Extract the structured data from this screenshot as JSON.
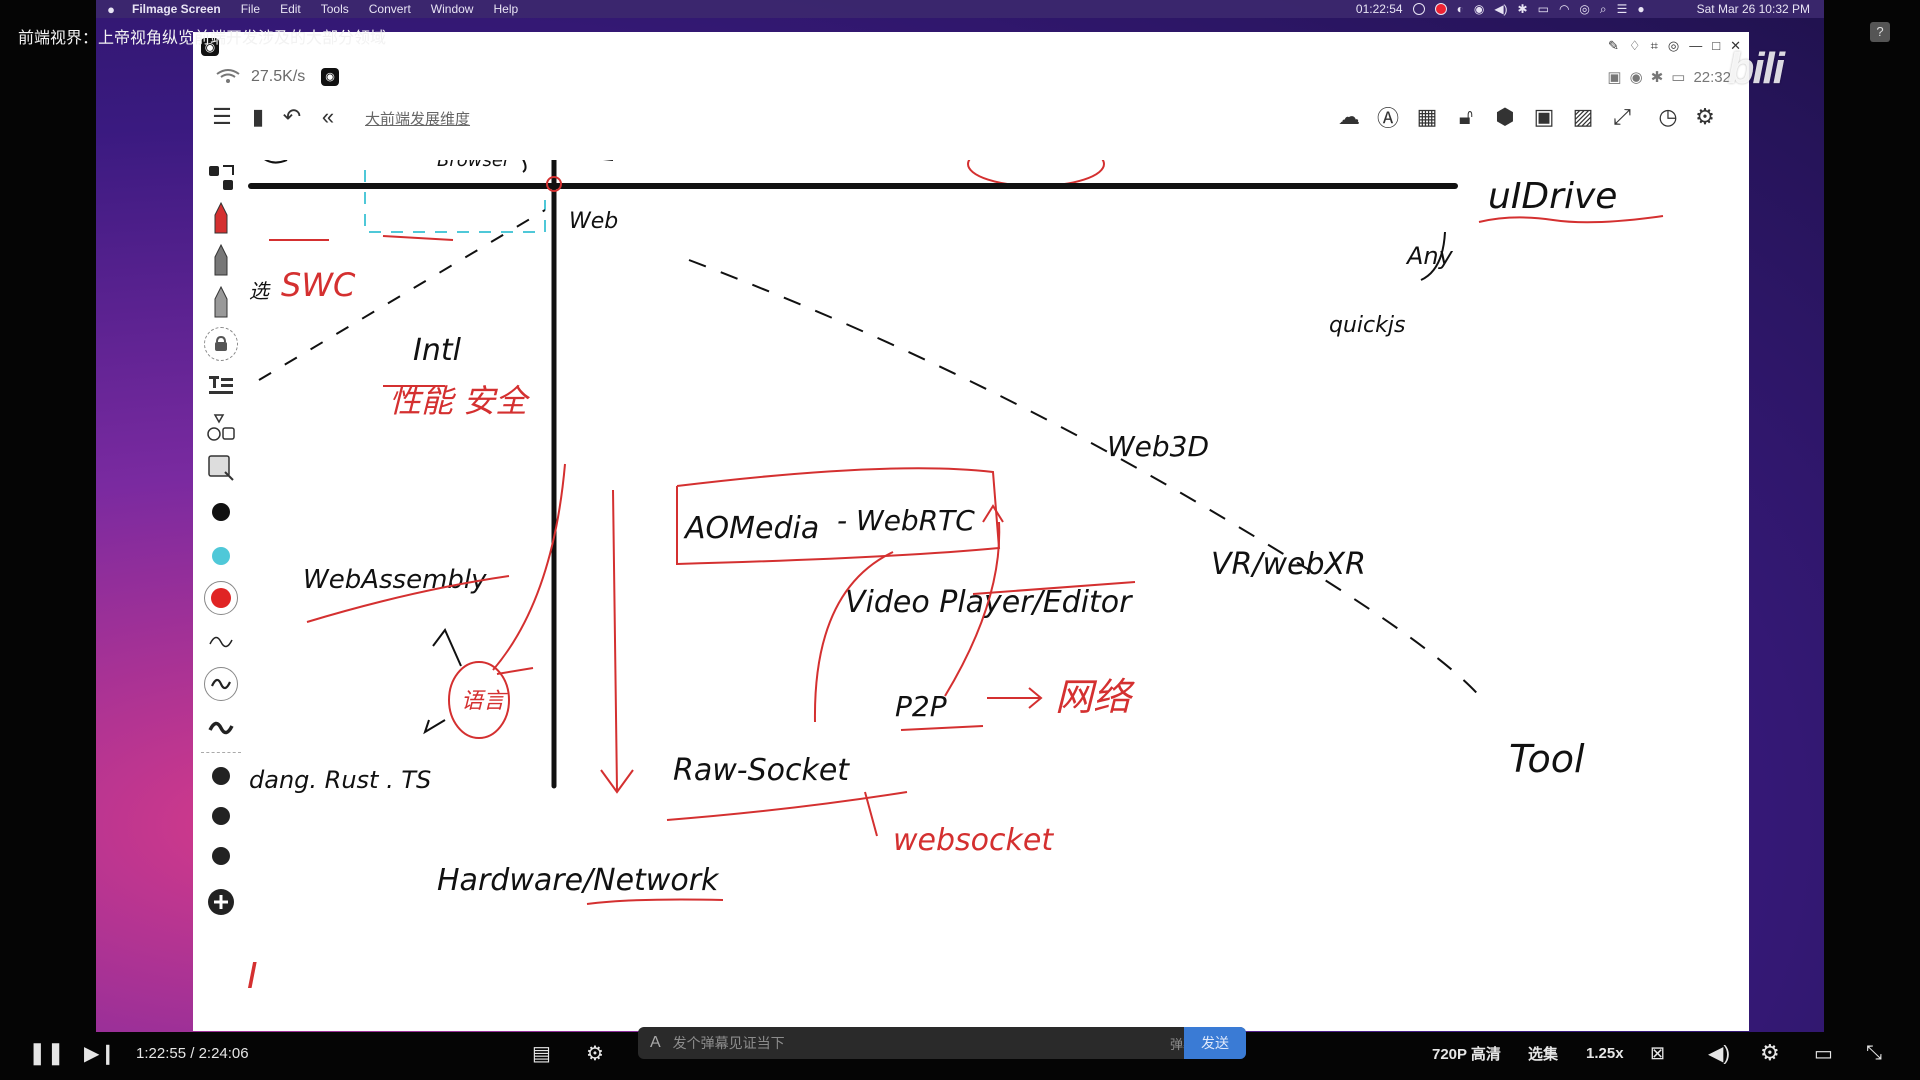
{
  "video": {
    "title": "前端视界：上帝视角纵览前端开发涉及的大部分领域",
    "current_time": "1:22:55",
    "separator": "/",
    "total_time": "2:24:06",
    "quality": "720P 高清",
    "episodes": "选集",
    "speed": "1.25x"
  },
  "danmaku": {
    "placeholder": "发个弹幕见证当下",
    "etiquette": "弹幕礼仪 ›",
    "send_label": "发送"
  },
  "menubar": {
    "app_name": "Filmage Screen",
    "menus": [
      "File",
      "Edit",
      "Tools",
      "Convert",
      "Window",
      "Help"
    ],
    "rec_time": "01:22:54",
    "datetime": "Sat Mar 26  10:32 PM"
  },
  "app": {
    "net_speed": "27.5K/s",
    "clock": "22:32",
    "doc_title": "大前端发展维度"
  },
  "canvas_labels": {
    "browser": "Browser",
    "web": "Web",
    "uidrive": "uIDrive",
    "any": "Any",
    "quickjs": "quickjs",
    "swc": "SWC",
    "intl": "Intl",
    "perf_security": "性能 安全",
    "web3d": "Web3D",
    "aomedia": "AOMedia",
    "webrtc": "- WebRTC",
    "webassembly": "WebAssembly",
    "video_player": "Video Player/Editor",
    "vr_webxr": "VR/webXR",
    "p2p": "P2P",
    "network": "网络",
    "lang": "语言",
    "langs": "dang. Rust . TS",
    "raw_socket": "Raw-Socket",
    "tool": "Tool",
    "websocket": "websocket",
    "hardware_network": "Hardware/Network",
    "cursor": "I"
  },
  "colors": {
    "pen_black": "#111111",
    "pen_red": "#d43030",
    "pen_cyan": "#4fc8d8",
    "brand_blue": "#3a7bd5"
  }
}
